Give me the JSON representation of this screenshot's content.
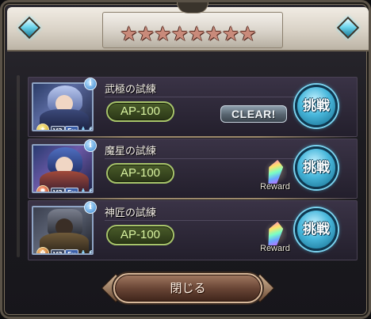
{
  "header": {
    "stars": "★★★★★★★★"
  },
  "trials": [
    {
      "title": "武極の試練",
      "ap": "AP-100",
      "status": "CLEAR!",
      "element": "light",
      "tag_v2": "V2",
      "tag_ex": "Ex",
      "plus_count": "6",
      "action": "挑戦"
    },
    {
      "title": "魔星の試練",
      "ap": "AP-100",
      "reward_label": "Reward",
      "element": "fire",
      "tag_v2": "V2",
      "tag_ex": "Ex",
      "plus_count": "6",
      "action": "挑戦"
    },
    {
      "title": "神匠の試練",
      "ap": "AP-100",
      "reward_label": "Reward",
      "element": "dark",
      "tag_v2": "V2",
      "tag_ex": "Ex",
      "plus_count": "6",
      "action": "挑戦"
    }
  ],
  "footer": {
    "close_label": "閉じる"
  },
  "colors": {
    "ap_text": "#d8f2a0",
    "challenge_button": "#49b8dc",
    "close_button": "#6a4636"
  },
  "icons": {
    "info": "info-icon",
    "reward": "rainbow-crystal-icon",
    "corner": "diamond-gem-icon"
  }
}
